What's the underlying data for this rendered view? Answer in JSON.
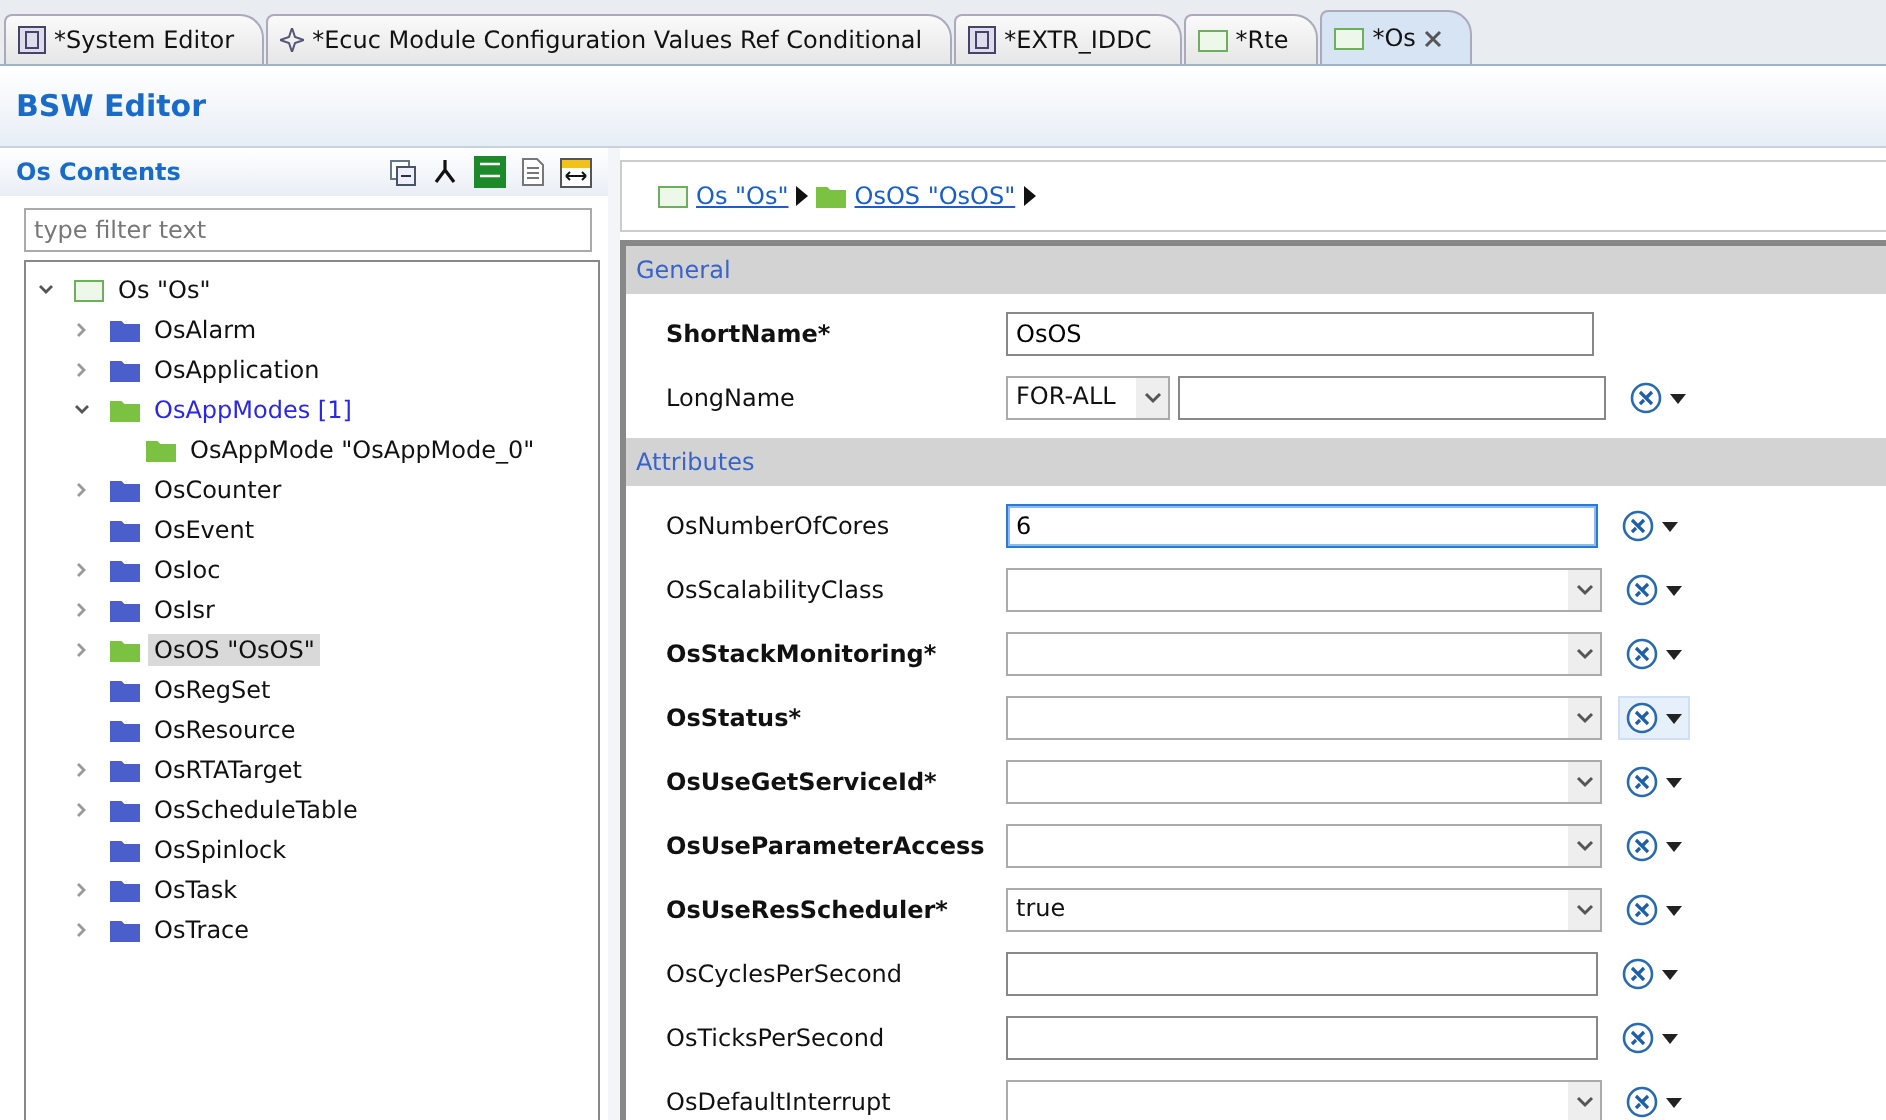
{
  "tabs": [
    {
      "label": "*System Editor",
      "kind": "module",
      "selected": false
    },
    {
      "label": "*Ecuc Module Configuration Values Ref Conditional",
      "kind": "sparkle",
      "selected": false
    },
    {
      "label": "*EXTR_IDDC",
      "kind": "module",
      "selected": false
    },
    {
      "label": "*Rte",
      "kind": "container",
      "selected": false
    },
    {
      "label": "*Os",
      "kind": "container",
      "selected": true
    }
  ],
  "editor": {
    "title": "BSW Editor"
  },
  "sidebar": {
    "title": "Os Contents",
    "filter": {
      "placeholder": "type filter text"
    },
    "tree": [
      {
        "label": "Os \"Os\"",
        "kind": "container",
        "expanded": true,
        "selected": false,
        "children": [
          {
            "label": "OsAlarm",
            "kind": "folder",
            "color": "#4a5fc9",
            "expanded": false,
            "selected": false
          },
          {
            "label": "OsApplication",
            "kind": "folder",
            "color": "#4a5fc9",
            "expanded": false,
            "selected": false
          },
          {
            "label": "OsAppModes [1]",
            "kind": "folder",
            "color": "#7cc242",
            "expanded": true,
            "selected": false,
            "linked": true,
            "children": [
              {
                "label": "OsAppMode \"OsAppMode_0\"",
                "kind": "folder",
                "color": "#7cc242",
                "selected": false
              }
            ]
          },
          {
            "label": "OsCounter",
            "kind": "folder",
            "color": "#4a5fc9",
            "expanded": false,
            "selected": false
          },
          {
            "label": "OsEvent",
            "kind": "folder",
            "color": "#4a5fc9",
            "selected": false
          },
          {
            "label": "OsIoc",
            "kind": "folder",
            "color": "#4a5fc9",
            "expanded": false,
            "selected": false
          },
          {
            "label": "OsIsr",
            "kind": "folder",
            "color": "#4a5fc9",
            "expanded": false,
            "selected": false
          },
          {
            "label": "OsOS \"OsOS\"",
            "kind": "folder",
            "color": "#7cc242",
            "expanded": false,
            "selected": true
          },
          {
            "label": "OsRegSet",
            "kind": "folder",
            "color": "#4a5fc9",
            "selected": false
          },
          {
            "label": "OsResource",
            "kind": "folder",
            "color": "#4a5fc9",
            "selected": false
          },
          {
            "label": "OsRTATarget",
            "kind": "folder",
            "color": "#4a5fc9",
            "expanded": false,
            "selected": false
          },
          {
            "label": "OsScheduleTable",
            "kind": "folder",
            "color": "#4a5fc9",
            "expanded": false,
            "selected": false
          },
          {
            "label": "OsSpinlock",
            "kind": "folder",
            "color": "#4a5fc9",
            "selected": false
          },
          {
            "label": "OsTask",
            "kind": "folder",
            "color": "#4a5fc9",
            "expanded": false,
            "selected": false
          },
          {
            "label": "OsTrace",
            "kind": "folder",
            "color": "#4a5fc9",
            "expanded": false,
            "selected": false
          }
        ]
      }
    ]
  },
  "breadcrumb": [
    {
      "label": "Os \"Os\"",
      "kind": "container"
    },
    {
      "label": "OsOS \"OsOS\"",
      "kind": "folder"
    }
  ],
  "sections": [
    {
      "title": "General",
      "fields": [
        {
          "label": "ShortName*",
          "required": true,
          "kind": "name",
          "value": "OsOS"
        },
        {
          "label": "LongName",
          "required": false,
          "kind": "lang",
          "lang": "FOR-ALL",
          "hovered": false
        }
      ]
    },
    {
      "title": "Attributes",
      "fields": [
        {
          "label": "OsNumberOfCores",
          "required": false,
          "kind": "text",
          "value": "6",
          "focused": true,
          "hovered": false
        },
        {
          "label": "OsScalabilityClass",
          "required": false,
          "kind": "select",
          "hovered": false
        },
        {
          "label": "OsStackMonitoring*",
          "required": true,
          "kind": "select",
          "hovered": false
        },
        {
          "label": "OsStatus*",
          "required": true,
          "kind": "select",
          "hovered": true
        },
        {
          "label": "OsUseGetServiceId*",
          "required": true,
          "kind": "select",
          "hovered": false
        },
        {
          "label": "OsUseParameterAccess",
          "required": true,
          "kind": "select",
          "hovered": false
        },
        {
          "label": "OsUseResScheduler*",
          "required": true,
          "kind": "select",
          "value": "true",
          "hovered": false
        },
        {
          "label": "OsCyclesPerSecond",
          "required": false,
          "kind": "text",
          "focused": false,
          "hovered": false
        },
        {
          "label": "OsTicksPerSecond",
          "required": false,
          "kind": "text",
          "focused": false,
          "hovered": false
        },
        {
          "label": "OsDefaultInterrupt",
          "required": false,
          "kind": "select",
          "hovered": false
        }
      ]
    }
  ]
}
